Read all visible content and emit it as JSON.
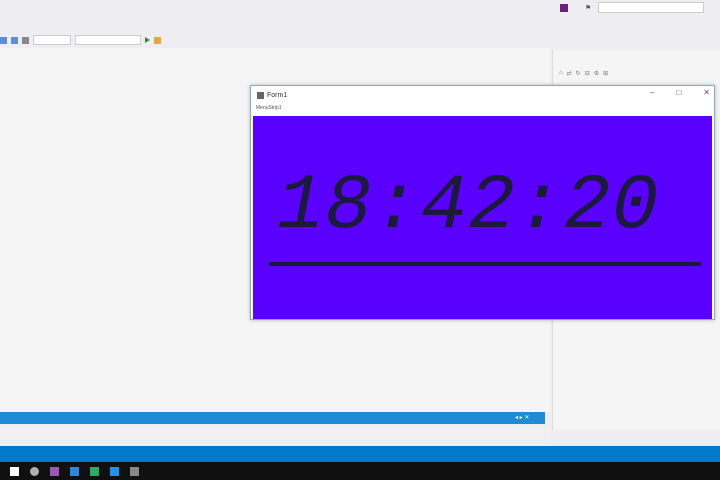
{
  "form": {
    "title": "Form1",
    "menu": "MenuStrip1",
    "clock_time": "18:42:20",
    "controls": [
      "–",
      "□",
      "✕"
    ],
    "clock_bg": "#5a00ff"
  },
  "icons": {
    "vs_flag": "vs-logo-icon",
    "notifications": "flag-icon",
    "form_icon": "form-icon",
    "start": "play-icon"
  },
  "taskbar_icons": [
    "start-icon",
    "search-icon",
    "taskview-icon",
    "explorer-icon",
    "chrome-icon",
    "visualstudio-icon",
    "app-icon"
  ],
  "colors": {
    "accent": "#007acc",
    "clock_panel": "#5a00ff",
    "progress": "#1f8ad6"
  }
}
